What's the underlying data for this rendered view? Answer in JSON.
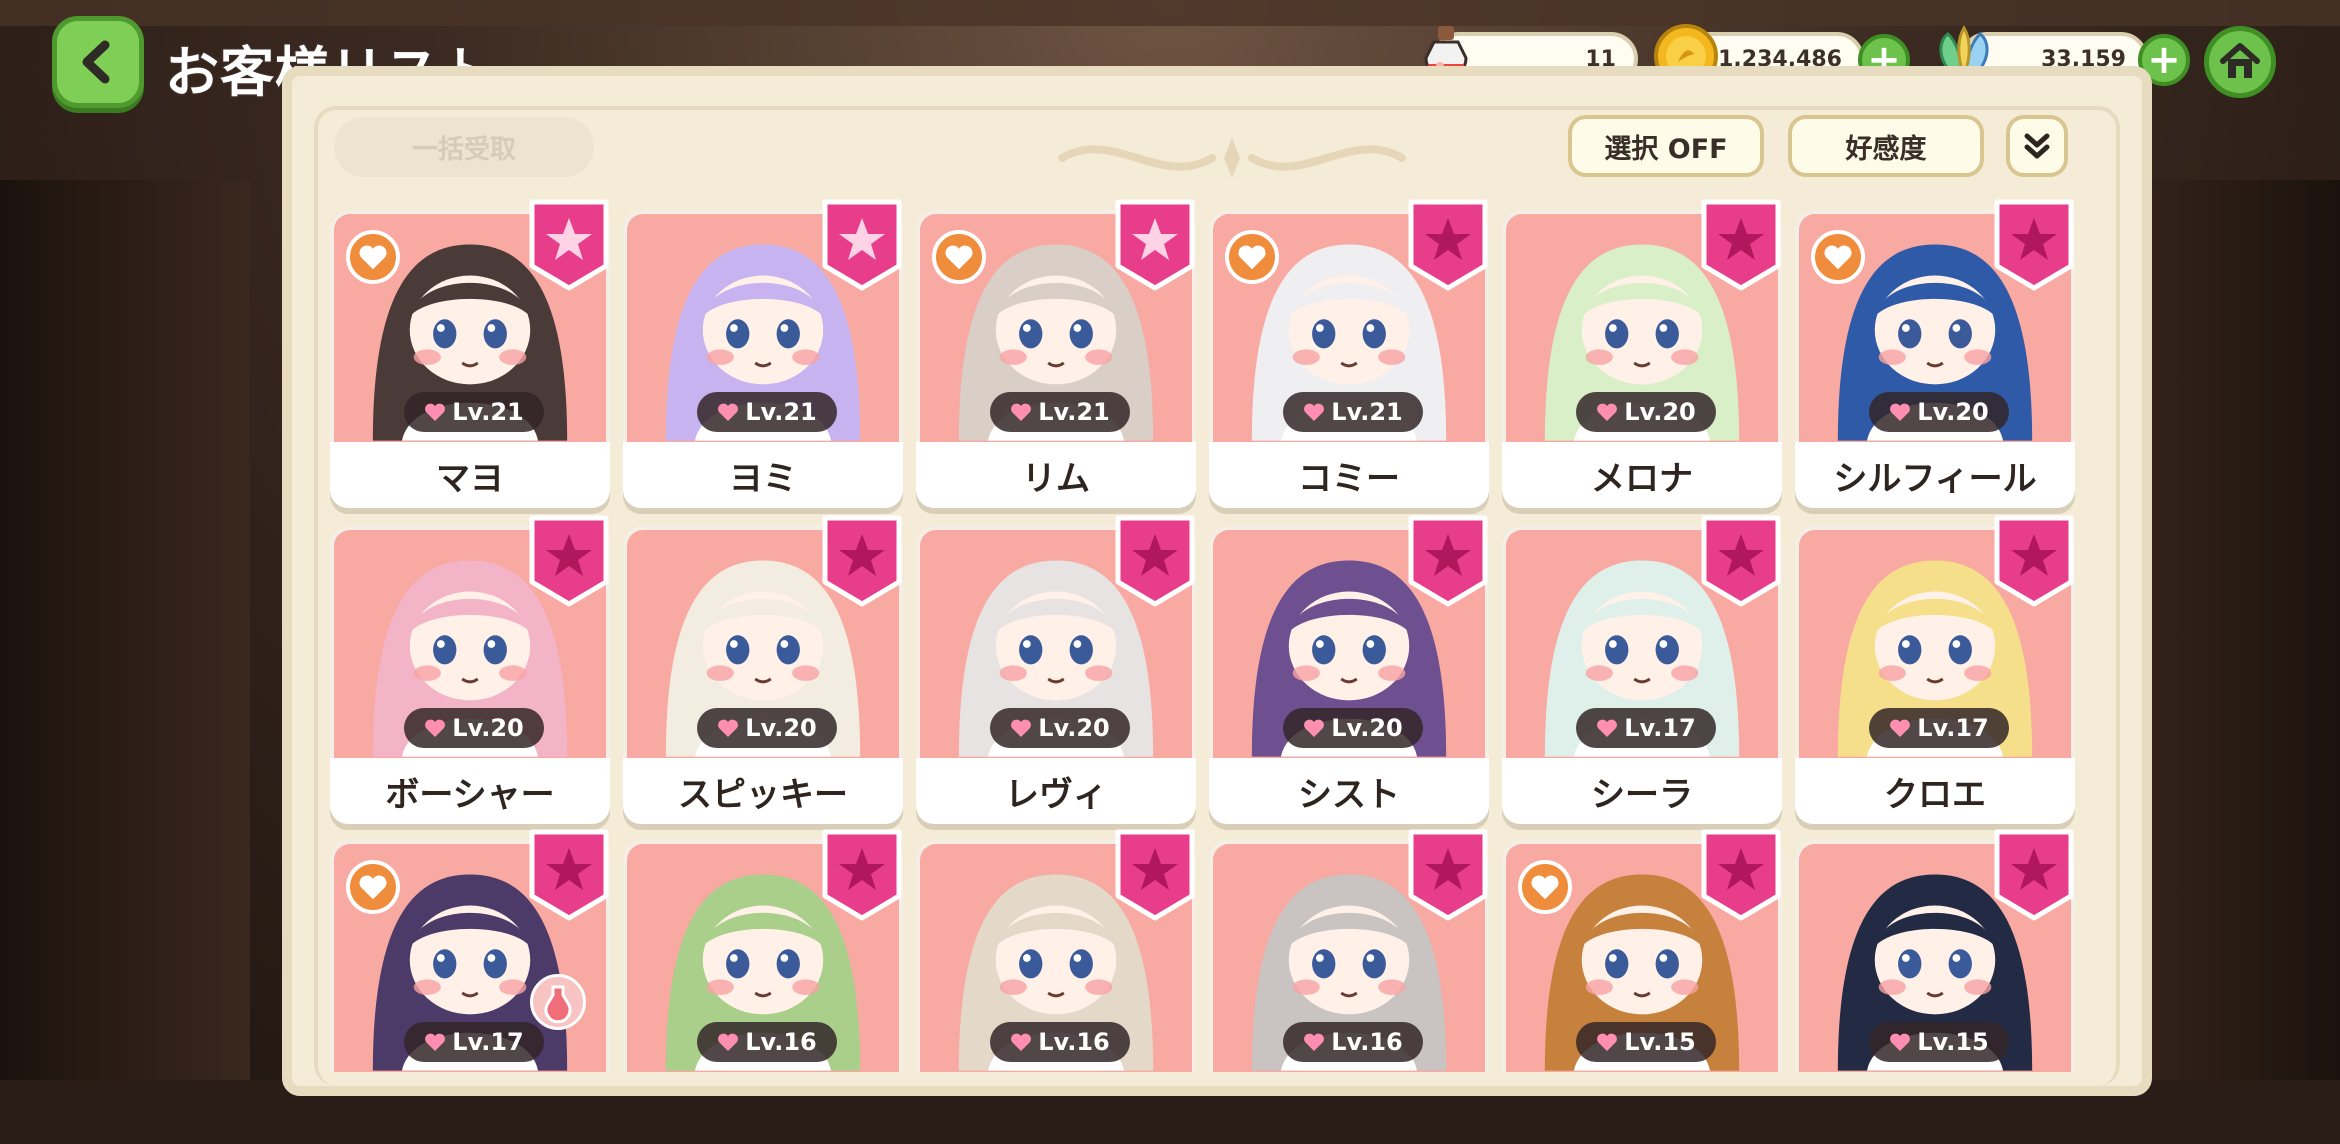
{
  "header": {
    "title": "お客様リスト"
  },
  "resources": {
    "potion": "11",
    "gold": "1,234,486",
    "gems": "33,159"
  },
  "toolbar": {
    "bulk_label": "一括受取",
    "select_label": "選択 OFF",
    "sort_label": "好感度"
  },
  "colors": {
    "accent_green": "#6cc24a",
    "card_bg": "#f8a9a2",
    "badge_pink": "#e83d8a",
    "fav_orange": "#f08d3c"
  },
  "customers": [
    {
      "name": "マヨ",
      "level": "Lv.21",
      "fav": true,
      "starred": true,
      "hair": "#4a3a38"
    },
    {
      "name": "ヨミ",
      "level": "Lv.21",
      "fav": false,
      "starred": true,
      "hair": "#c6b3ef"
    },
    {
      "name": "リム",
      "level": "Lv.21",
      "fav": true,
      "starred": true,
      "hair": "#d9cfc7"
    },
    {
      "name": "コミー",
      "level": "Lv.21",
      "fav": true,
      "starred": false,
      "hair": "#efeff2"
    },
    {
      "name": "メロナ",
      "level": "Lv.20",
      "fav": false,
      "starred": false,
      "hair": "#d8efc8"
    },
    {
      "name": "シルフィール",
      "level": "Lv.20",
      "fav": true,
      "starred": false,
      "hair": "#2f5aa8"
    },
    {
      "name": "ボーシャー",
      "level": "Lv.20",
      "fav": false,
      "starred": false,
      "hair": "#f3b4c8"
    },
    {
      "name": "スピッキー",
      "level": "Lv.20",
      "fav": false,
      "starred": false,
      "hair": "#f2ede0"
    },
    {
      "name": "レヴィ",
      "level": "Lv.20",
      "fav": false,
      "starred": false,
      "hair": "#e7e3e2"
    },
    {
      "name": "シスト",
      "level": "Lv.20",
      "fav": false,
      "starred": false,
      "hair": "#6e4f8f"
    },
    {
      "name": "シーラ",
      "level": "Lv.17",
      "fav": false,
      "starred": false,
      "hair": "#dff0ea"
    },
    {
      "name": "クロエ",
      "level": "Lv.17",
      "fav": false,
      "starred": false,
      "hair": "#f6df8a"
    },
    {
      "name": "",
      "level": "Lv.17",
      "fav": true,
      "starred": false,
      "hair": "#4c3a68"
    },
    {
      "name": "",
      "level": "Lv.16",
      "fav": false,
      "starred": false,
      "hair": "#a9cf8a"
    },
    {
      "name": "",
      "level": "Lv.16",
      "fav": false,
      "starred": false,
      "hair": "#e4d8c9"
    },
    {
      "name": "",
      "level": "Lv.16",
      "fav": false,
      "starred": false,
      "hair": "#c9c4c2"
    },
    {
      "name": "",
      "level": "Lv.15",
      "fav": true,
      "starred": false,
      "hair": "#c6813d"
    },
    {
      "name": "",
      "level": "Lv.15",
      "fav": false,
      "starred": false,
      "hair": "#222a44"
    }
  ]
}
